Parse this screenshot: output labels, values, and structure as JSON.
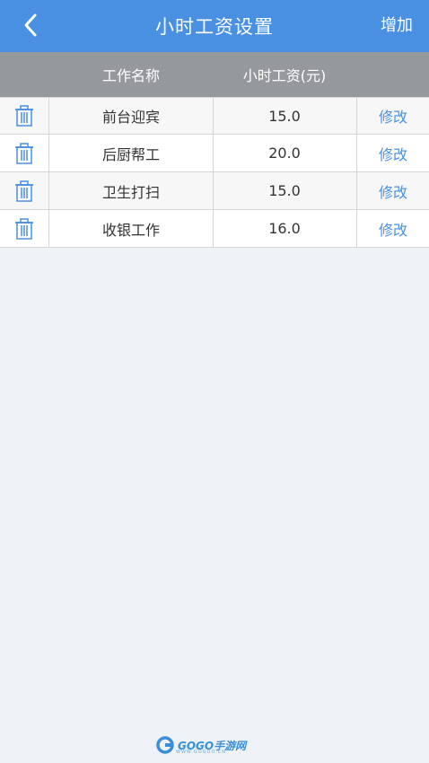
{
  "header": {
    "title": "小时工资设置",
    "add_label": "增加"
  },
  "table": {
    "columns": [
      "工作名称",
      "小时工资(元)"
    ],
    "rows": [
      {
        "name": "前台迎宾",
        "wage": "15.0",
        "edit": "修改"
      },
      {
        "name": "后厨帮工",
        "wage": "20.0",
        "edit": "修改"
      },
      {
        "name": "卫生打扫",
        "wage": "15.0",
        "edit": "修改"
      },
      {
        "name": "收银工作",
        "wage": "16.0",
        "edit": "修改"
      }
    ]
  },
  "watermark": {
    "brand": "GOGO手游网",
    "url": "WWW.GOGOO.CN"
  },
  "colors": {
    "accent": "#4a90e2",
    "header_bg": "#95989d",
    "page_bg": "#eff3f7"
  },
  "icons": {
    "back": "chevron-left-icon",
    "delete": "trash-icon"
  }
}
